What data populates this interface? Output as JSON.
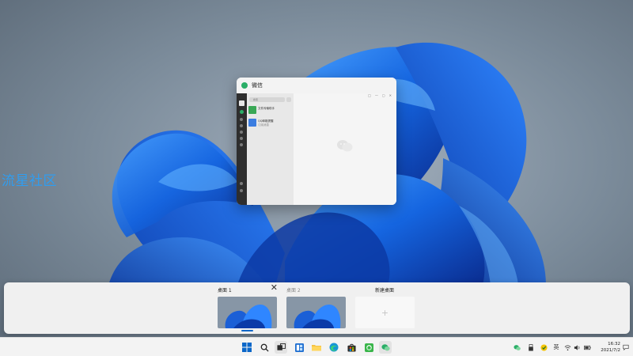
{
  "watermark": "流星社区",
  "app_window": {
    "title": "微信",
    "search_placeholder": "搜索",
    "conversations": [
      {
        "title": "文件传输助手",
        "subtitle": "",
        "time": ""
      },
      {
        "title": "QQ邮箱提醒",
        "subtitle": "订阅消息",
        "time": ""
      }
    ],
    "window_controls": [
      "□",
      "—",
      "▢",
      "✕"
    ]
  },
  "task_view": {
    "desktops": [
      {
        "label": "桌面 1",
        "active": true,
        "close_symbol": "✕"
      },
      {
        "label": "桌面 2",
        "active": false
      }
    ],
    "new_desktop_label": "新建桌面",
    "new_desktop_plus": "+"
  },
  "taskbar": {
    "icons": [
      "start-icon",
      "search-icon",
      "task-view-icon",
      "widgets-icon",
      "file-explorer-icon",
      "edge-icon",
      "store-icon",
      "vpn-icon",
      "wechat-icon"
    ],
    "tray_symbols": {
      "input": "英"
    },
    "clock": {
      "time": "16:32",
      "date": "2021/7/2"
    }
  },
  "colors": {
    "accent": "#0b67c9",
    "wechat_green": "#2aae67",
    "watermark": "#2f9df0"
  }
}
